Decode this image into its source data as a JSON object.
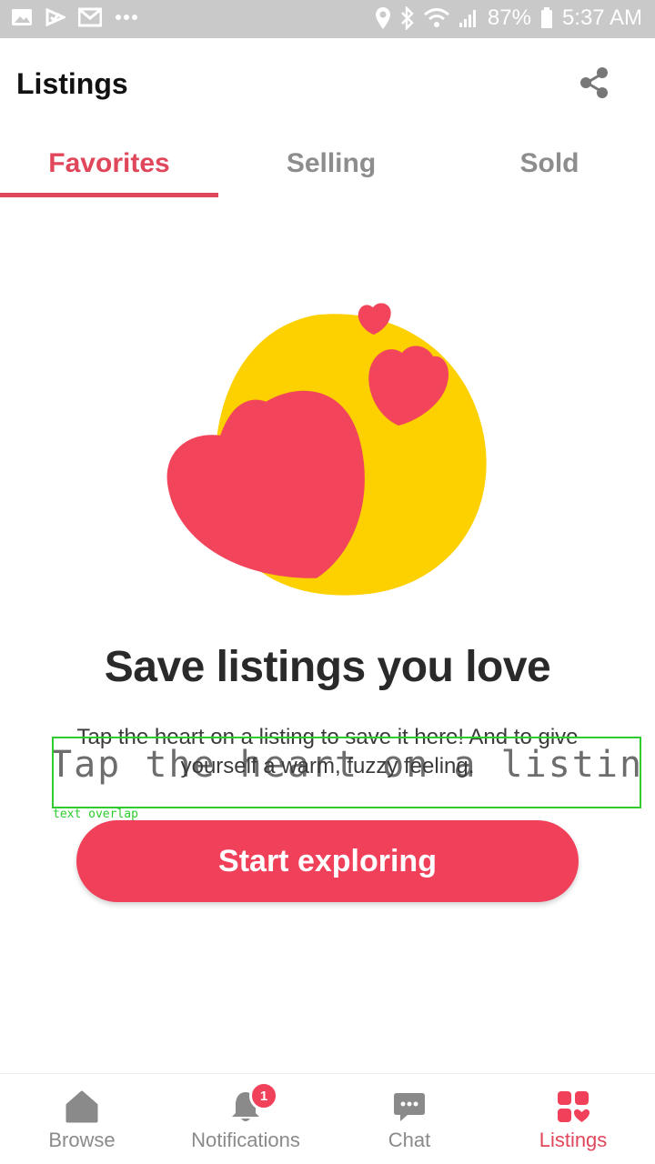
{
  "status_bar": {
    "battery": "87%",
    "time": "5:37 AM",
    "left_icons": [
      "gallery-icon",
      "check-play-icon",
      "gmail-icon",
      "more-dots-icon"
    ],
    "right_icons": [
      "location-icon",
      "bluetooth-icon",
      "wifi-icon",
      "signal-icon",
      "battery-icon"
    ]
  },
  "header": {
    "title": "Listings",
    "share_icon": "share-icon"
  },
  "tabs": [
    {
      "label": "Favorites",
      "active": true
    },
    {
      "label": "Selling",
      "active": false
    },
    {
      "label": "Sold",
      "active": false
    }
  ],
  "empty_state": {
    "headline": "Save listings you love",
    "body": "Tap the heart on a listing to save it here! And to give yourself a warm, fuzzy feeling.",
    "button_label": "Start exploring",
    "overlay_text": "Tap the heart on a listing to save",
    "overlay_label": "text overlap"
  },
  "bottom_nav": [
    {
      "label": "Browse",
      "icon": "home-icon",
      "active": false
    },
    {
      "label": "Notifications",
      "icon": "bell-icon",
      "active": false,
      "badge": "1"
    },
    {
      "label": "Chat",
      "icon": "chat-bubble-icon",
      "active": false
    },
    {
      "label": "Listings",
      "icon": "grid-heart-icon",
      "active": true
    }
  ],
  "colors": {
    "accent": "#e0475b",
    "button": "#f0405a",
    "illustration_yellow": "#fdd000",
    "heart_red": "#f2445b",
    "inactive": "#8d8d8d",
    "status_bar": "#c9c9c9"
  }
}
